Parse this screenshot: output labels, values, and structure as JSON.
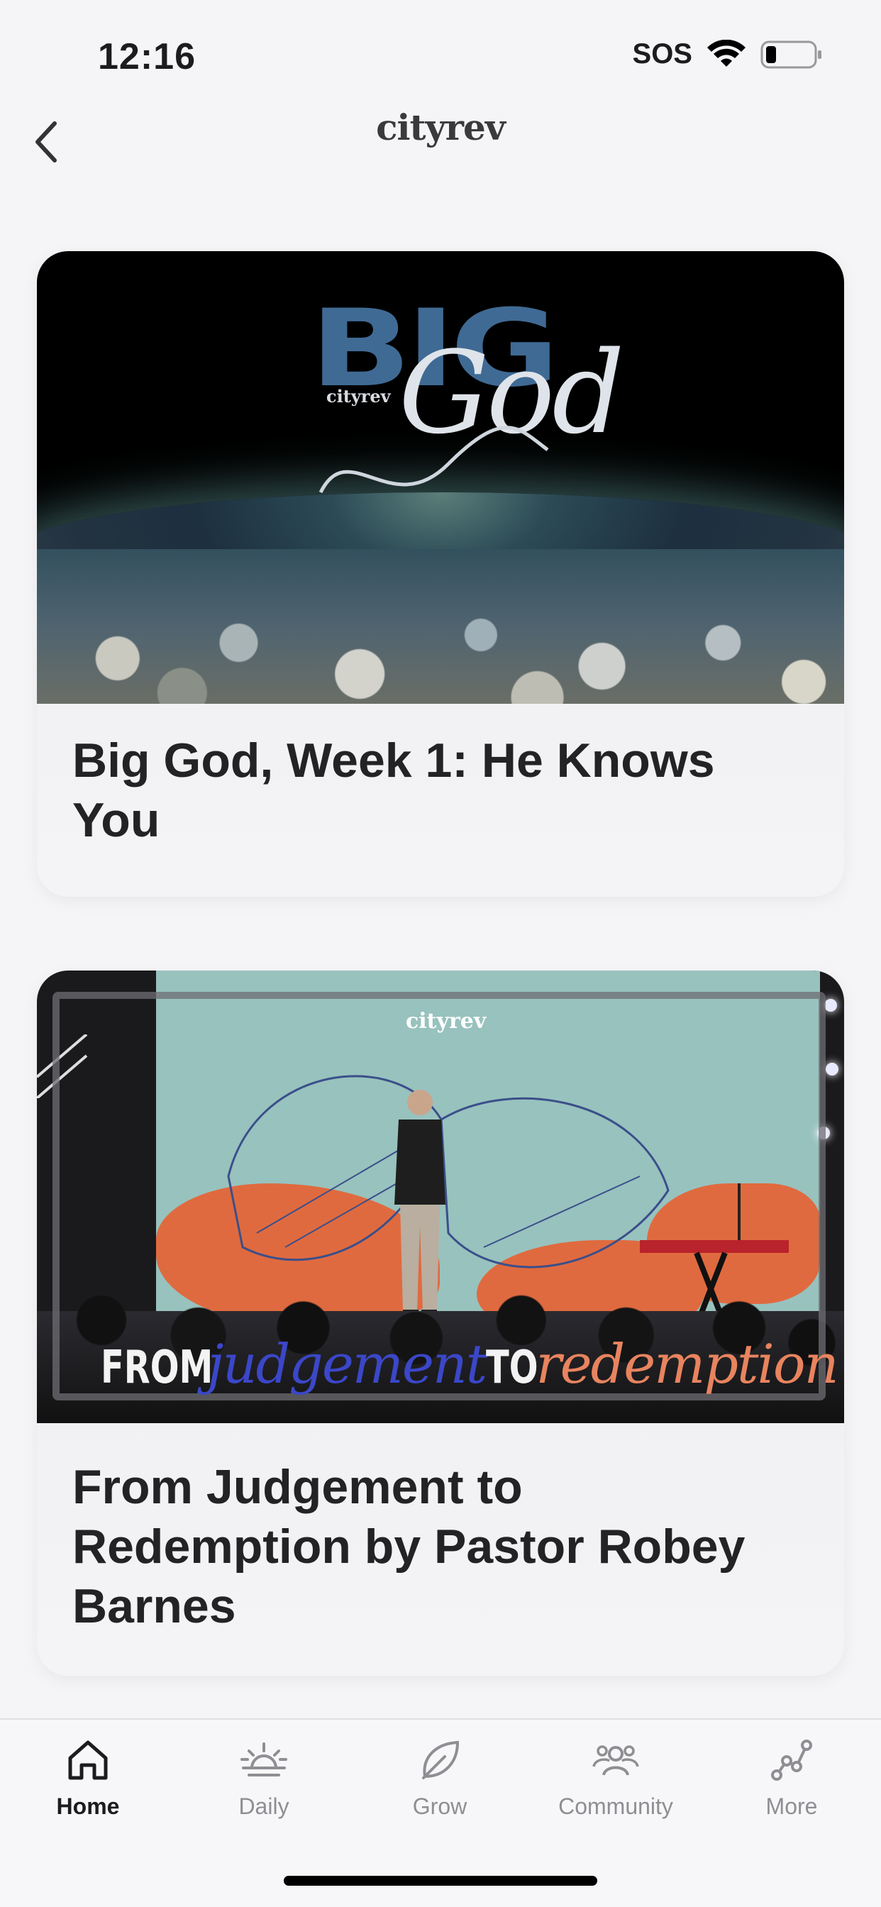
{
  "status_bar": {
    "time": "12:16",
    "sos": "SOS"
  },
  "header": {
    "brand": "cityrev"
  },
  "cards": [
    {
      "title": "Big God, Week 1: He Knows You",
      "image_text": {
        "big": "BIG",
        "god": "God",
        "mini_logo": "cityrev"
      }
    },
    {
      "title": "From Judgement to Redemption by Pastor Robey Barnes",
      "image_text": {
        "logo": "cityrev",
        "from": "FROM",
        "judgement": "judgement",
        "to": "TO",
        "redemption": "redemption"
      }
    }
  ],
  "tab_bar": {
    "tabs": [
      {
        "label": "Home",
        "icon": "home-icon",
        "active": true
      },
      {
        "label": "Daily",
        "icon": "sunrise-icon",
        "active": false
      },
      {
        "label": "Grow",
        "icon": "leaf-icon",
        "active": false
      },
      {
        "label": "Community",
        "icon": "people-icon",
        "active": false
      },
      {
        "label": "More",
        "icon": "nodes-icon",
        "active": false
      }
    ]
  },
  "colors": {
    "background": "#f5f5f7",
    "active_tab": "#1c1c1e",
    "inactive_tab": "#8e8e93",
    "big_blue": "#3f6a94",
    "accent_orange": "#e06a3f",
    "accent_blue": "#3b47c8"
  }
}
